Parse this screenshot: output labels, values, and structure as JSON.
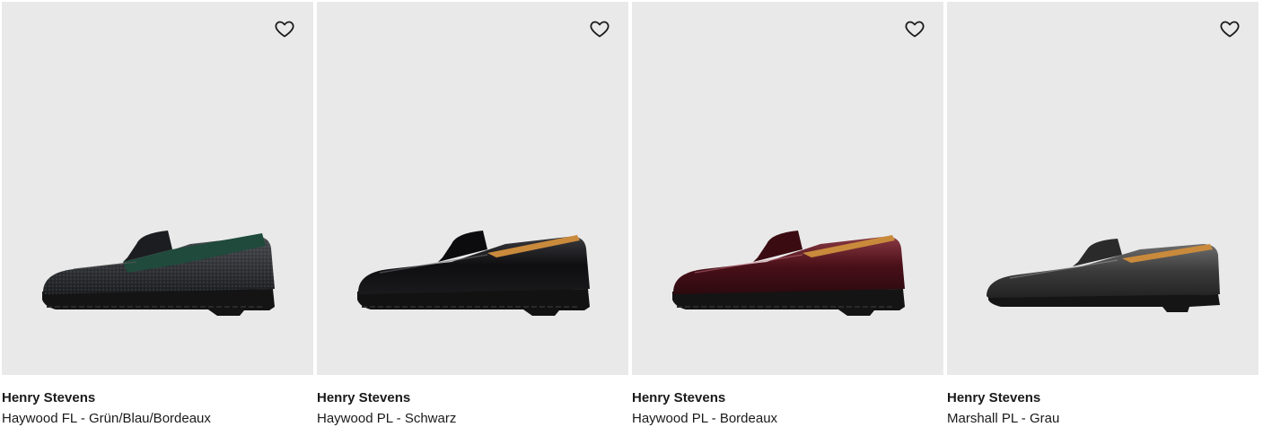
{
  "products": [
    {
      "brand": "Henry Stevens",
      "name": "Haywood FL - Grün/Blau/Bordeaux",
      "wishlist_icon": "heart-outline-icon",
      "shoe_color": "#2a2c30",
      "accent_color": "#1f4a3c"
    },
    {
      "brand": "Henry Stevens",
      "name": "Haywood PL - Schwarz",
      "wishlist_icon": "heart-outline-icon",
      "shoe_color": "#121214",
      "accent_color": "#121214"
    },
    {
      "brand": "Henry Stevens",
      "name": "Haywood PL - Bordeaux",
      "wishlist_icon": "heart-outline-icon",
      "shoe_color": "#4a1018",
      "accent_color": "#4a1018"
    },
    {
      "brand": "Henry Stevens",
      "name": "Marshall PL - Grau",
      "wishlist_icon": "heart-outline-icon",
      "shoe_color": "#3b3b3b",
      "accent_color": "#3b3b3b"
    }
  ],
  "colors": {
    "image_background": "#e9e9e9",
    "text": "#1a1a1a",
    "lining": "#c98a3c"
  }
}
